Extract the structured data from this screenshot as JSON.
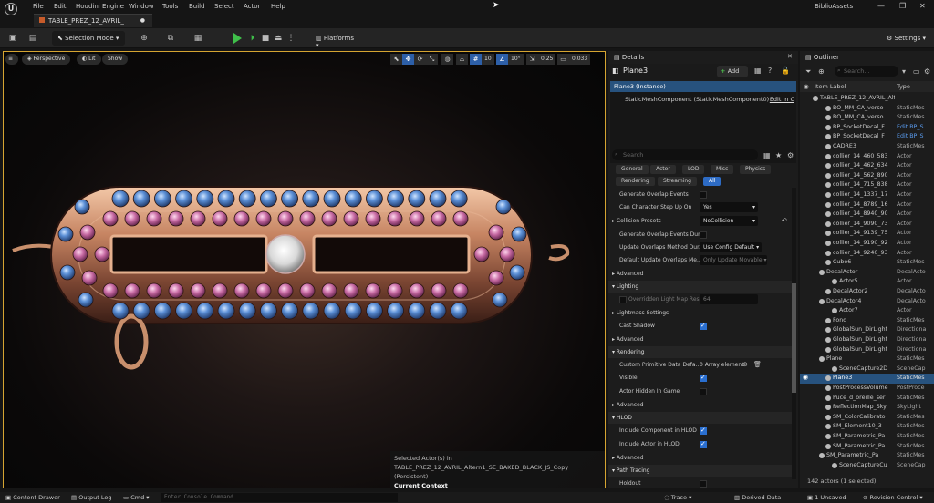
{
  "menu": [
    "File",
    "Edit",
    "Houdini Engine",
    "Window",
    "Tools",
    "Build",
    "Select",
    "Actor",
    "Help"
  ],
  "window_title": "BiblioAssets",
  "tab": {
    "label": "TABLE_PREZ_12_AVRIL_"
  },
  "toolbar": {
    "selection_mode": "Selection Mode",
    "platforms": "Platforms",
    "settings": "Settings"
  },
  "viewport": {
    "perspective": "Perspective",
    "lit": "Lit",
    "show": "Show",
    "grid_snap": "10",
    "rot_snap": "10°",
    "scale_snap": "0,25",
    "cam_speed": "0,033",
    "context": {
      "line1": "Selected Actor(s) in",
      "line2": "TABLE_PREZ_12_AVRIL_Altern1_SE_BAKED_BLACK_JS_Copy (Persistent)",
      "line3": "Current Context"
    }
  },
  "details": {
    "tab": "Details",
    "actor": "Plane3",
    "add": "Add",
    "instance": "Plane3 (Instance)",
    "component": "StaticMeshComponent (StaticMeshComponent0)",
    "edit_link": "Edit in C",
    "search_placeholder": "Search",
    "filters_row1": [
      "General",
      "Actor",
      "LOD",
      "Misc",
      "Physics"
    ],
    "filters_row2": [
      "Rendering",
      "Streaming",
      "All"
    ],
    "props": {
      "gen_overlap": "Generate Overlap Events",
      "can_step": "Can Character Step Up On",
      "can_step_val": "Yes",
      "collision": "Collision Presets",
      "collision_val": "NoCollision",
      "gen_overlap_dur": "Generate Overlap Events Dur...",
      "upd_overlap": "Update Overlaps Method Dur...",
      "upd_overlap_val": "Use Config Default",
      "def_upd_overlap": "Default Update Overlaps Me...",
      "def_upd_overlap_val": "Only Update Movable",
      "advanced": "Advanced",
      "lighting": "Lighting",
      "overridden": "Overridden Light Map Res",
      "overridden_val": "64",
      "lightmass": "Lightmass Settings",
      "cast_shadow": "Cast Shadow",
      "rendering": "Rendering",
      "custom_prim": "Custom Primitive Data Defa...",
      "custom_prim_val": "0 Array element",
      "visible": "Visible",
      "hidden_game": "Actor Hidden In Game",
      "hlod": "HLOD",
      "incl_comp": "Include Component in HLOD",
      "incl_actor": "Include Actor in HLOD",
      "path_tracing": "Path Tracing",
      "holdout": "Holdout"
    }
  },
  "outliner": {
    "tab": "Outliner",
    "search_placeholder": "Search...",
    "col_label": "Item Label",
    "col_type": "Type",
    "rows": [
      {
        "name": "TABLE_PREZ_12_AVRIL_Altern1",
        "type": "",
        "indent": 0
      },
      {
        "name": "BO_MM_CA_verso",
        "type": "StaticMes",
        "indent": 2
      },
      {
        "name": "BO_MM_CA_verso",
        "type": "StaticMes",
        "indent": 2
      },
      {
        "name": "BP_SocketDecal_F",
        "type": "Edit BP_S",
        "indent": 2,
        "link": true
      },
      {
        "name": "BP_SocketDecal_F",
        "type": "Edit BP_S",
        "indent": 2,
        "link": true
      },
      {
        "name": "CADRE3",
        "type": "StaticMes",
        "indent": 2
      },
      {
        "name": "collier_14_460_583",
        "type": "Actor",
        "indent": 2
      },
      {
        "name": "collier_14_462_634",
        "type": "Actor",
        "indent": 2
      },
      {
        "name": "collier_14_562_890",
        "type": "Actor",
        "indent": 2
      },
      {
        "name": "collier_14_715_838",
        "type": "Actor",
        "indent": 2
      },
      {
        "name": "collier_14_1337_17",
        "type": "Actor",
        "indent": 2
      },
      {
        "name": "collier_14_8789_16",
        "type": "Actor",
        "indent": 2
      },
      {
        "name": "collier_14_8940_90",
        "type": "Actor",
        "indent": 2
      },
      {
        "name": "collier_14_9090_73",
        "type": "Actor",
        "indent": 2
      },
      {
        "name": "collier_14_9139_75",
        "type": "Actor",
        "indent": 2
      },
      {
        "name": "collier_14_9190_92",
        "type": "Actor",
        "indent": 2
      },
      {
        "name": "collier_14_9240_93",
        "type": "Actor",
        "indent": 2
      },
      {
        "name": "Cube6",
        "type": "StaticMes",
        "indent": 2
      },
      {
        "name": "DecalActor",
        "type": "DecalActo",
        "indent": 1
      },
      {
        "name": "Actor5",
        "type": "Actor",
        "indent": 3
      },
      {
        "name": "DecalActor2",
        "type": "DecalActo",
        "indent": 2
      },
      {
        "name": "DecalActor4",
        "type": "DecalActo",
        "indent": 1
      },
      {
        "name": "Actor7",
        "type": "Actor",
        "indent": 3
      },
      {
        "name": "Fond",
        "type": "StaticMes",
        "indent": 2
      },
      {
        "name": "GlobalSun_DirLight",
        "type": "Directiona",
        "indent": 2
      },
      {
        "name": "GlobalSun_DirLight",
        "type": "Directiona",
        "indent": 2
      },
      {
        "name": "GlobalSun_DirLight",
        "type": "Directiona",
        "indent": 2
      },
      {
        "name": "Plane",
        "type": "StaticMes",
        "indent": 1
      },
      {
        "name": "SceneCapture2D",
        "type": "SceneCap",
        "indent": 3
      },
      {
        "name": "Plane3",
        "type": "StaticMes",
        "indent": 2,
        "selected": true
      },
      {
        "name": "PostProcessVolume",
        "type": "PostProce",
        "indent": 2
      },
      {
        "name": "Puce_d_oreille_ser",
        "type": "StaticMes",
        "indent": 2
      },
      {
        "name": "ReflectionMap_Sky",
        "type": "SkyLight",
        "indent": 2
      },
      {
        "name": "SM_ColorCalibrato",
        "type": "StaticMes",
        "indent": 2
      },
      {
        "name": "SM_Element10_3",
        "type": "StaticMes",
        "indent": 2
      },
      {
        "name": "SM_Parametric_Pa",
        "type": "StaticMes",
        "indent": 2
      },
      {
        "name": "SM_Parametric_Pa",
        "type": "StaticMes",
        "indent": 2
      },
      {
        "name": "SM_Parametric_Pa",
        "type": "StaticMes",
        "indent": 1
      },
      {
        "name": "SceneCaptureCu",
        "type": "SceneCap",
        "indent": 3
      }
    ],
    "footer": "142 actors (1 selected)"
  },
  "statusbar": {
    "content_drawer": "Content Drawer",
    "output_log": "Output Log",
    "cmd": "Cmd",
    "console_placeholder": "Enter Console Command",
    "trace": "Trace",
    "derived_data": "Derived Data",
    "unsaved": "1 Unsaved",
    "revision": "Revision Control"
  }
}
